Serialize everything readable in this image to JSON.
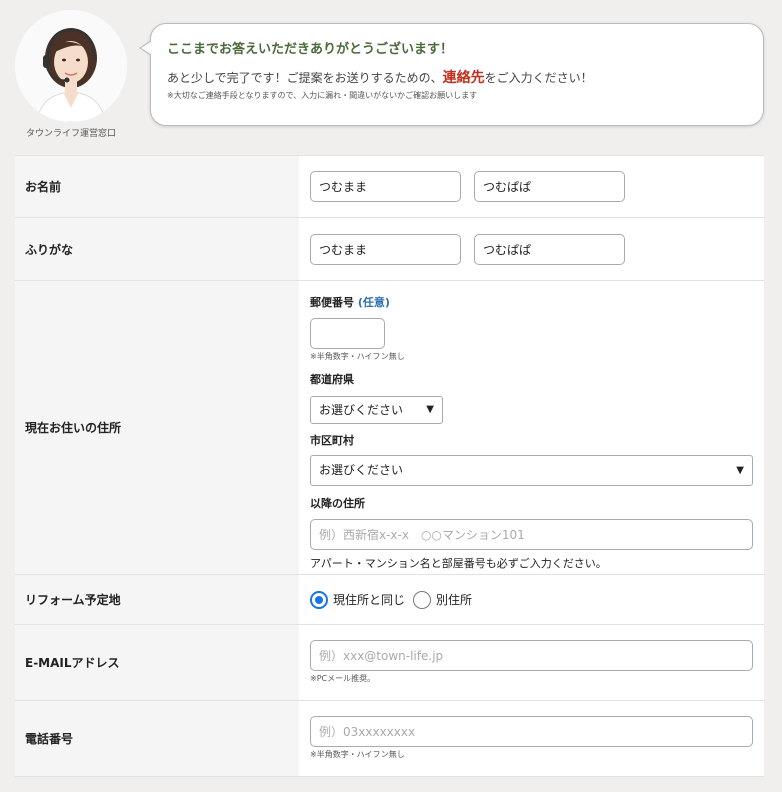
{
  "header": {
    "avatar_caption": "タウンライフ運営窓口",
    "title": "ここまでお答えいただきありがとうございます！",
    "message_before": "あと少しで完了です！ご提案をお送りするための、",
    "message_highlight": "連絡先",
    "message_after": "をご入力ください！",
    "note": "※大切なご連絡手段となりますので、入力に漏れ・間違いがないかご確認お願いします"
  },
  "form": {
    "name": {
      "label": "お名前",
      "last_value": "つむまま",
      "first_value": "つむぱぱ"
    },
    "furigana": {
      "label": "ふりがな",
      "last_value": "つむまま",
      "first_value": "つむぱぱ"
    },
    "address": {
      "label": "現在お住いの住所",
      "postal_label": "郵便番号",
      "postal_optional": "(任意)",
      "postal_value": "",
      "postal_hint": "※半角数字・ハイフン無し",
      "prefecture_label": "都道府県",
      "prefecture_selected": "お選びください",
      "city_label": "市区町村",
      "city_selected": "お選びください",
      "street_label": "以降の住所",
      "street_placeholder": "例）西新宿x-x-x　○○マンション101",
      "street_note": "アパート・マンション名と部屋番号も必ずご入力ください。"
    },
    "reform": {
      "label": "リフォーム予定地",
      "option_same": "現住所と同じ",
      "option_other": "別住所",
      "selected": "現住所と同じ"
    },
    "email": {
      "label": "E-MAILアドレス",
      "placeholder": "例）xxx@town-life.jp",
      "hint": "※PCメール推奨。"
    },
    "phone": {
      "label": "電話番号",
      "placeholder": "例）03xxxxxxxx",
      "hint": "※半角数字・ハイフン無し"
    }
  },
  "colors": {
    "title_green": "#4a6a3a",
    "highlight_red": "#c0311f",
    "optional_blue": "#2f6fb0",
    "radio_blue": "#1a73e8"
  },
  "icons": {
    "select_caret": "▼"
  }
}
